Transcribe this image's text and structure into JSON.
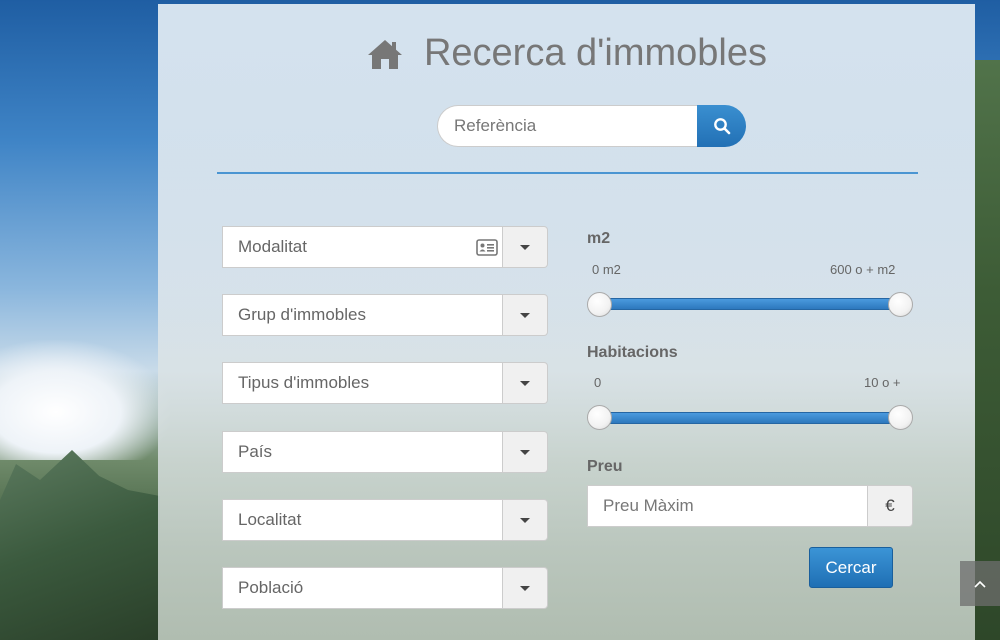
{
  "header": {
    "title": "Recerca d'immobles",
    "icon": "home-icon"
  },
  "search": {
    "placeholder": "Referència",
    "value": "",
    "button_icon": "search-icon"
  },
  "filters": {
    "modalitat": "Modalitat",
    "grup": "Grup d'immobles",
    "tipus": "Tipus d'immobles",
    "pais": "País",
    "localitat": "Localitat",
    "poblacio": "Població"
  },
  "m2": {
    "label": "m2",
    "min_label": "0 m2",
    "max_label": "600 o + m2",
    "min_value": 0,
    "max_value": 600
  },
  "habitacions": {
    "label": "Habitacions",
    "min_label": "0",
    "max_label": "10 o +",
    "min_value": 0,
    "max_value": 10
  },
  "preu": {
    "label": "Preu",
    "placeholder": "Preu Màxim",
    "currency": "€"
  },
  "actions": {
    "submit_label": "Cercar"
  },
  "colors": {
    "accent": "#2a7cc2",
    "title": "#777777"
  }
}
